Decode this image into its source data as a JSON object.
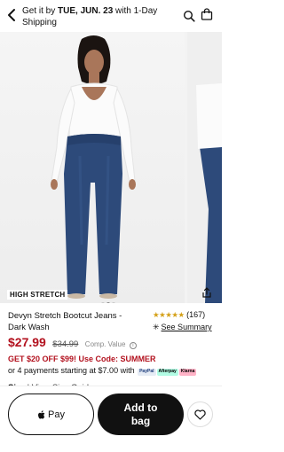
{
  "header": {
    "ship_prefix": "Get it by ",
    "ship_date": "TUE, JUN. 23",
    "ship_suffix": " with 1-Day Shipping",
    "icons": {
      "back": "chevron-left-icon",
      "search": "search-icon",
      "bag": "shopping-bag-icon"
    }
  },
  "gallery": {
    "badge": "HIGH STRETCH",
    "dots": 3,
    "active_dot": 1
  },
  "product": {
    "name": "Devyn Stretch Bootcut Jeans - Dark Wash",
    "rating_stars": "★★★★★",
    "rating_value": 4.5,
    "review_count": "(167)",
    "summary_label": "See Summary",
    "price": "$27.99",
    "original_price": "$34.99",
    "comp_label": "Comp. Value",
    "promo": "GET $20 OFF $99! Use Code: SUMMER",
    "installments": "or 4 payments starting at $7.00 with",
    "pay_options": [
      "PayPal",
      "Afterpay",
      "Klarna"
    ],
    "size_label": "Size",
    "size_guide": "| View Size Guide"
  },
  "footer": {
    "applepay_label": "Pay",
    "add_to_bag_label": "Add to bag"
  },
  "colors": {
    "price_red": "#b3121f",
    "star_gold": "#d4a017",
    "denim": "#2d4a7a"
  }
}
